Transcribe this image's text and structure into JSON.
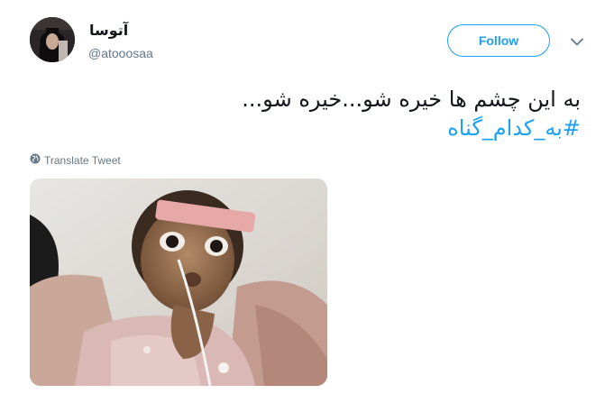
{
  "user": {
    "display_name": "آتوسا",
    "handle": "@atooosaa",
    "avatar_icon": "profile-photo"
  },
  "follow_label": "Follow",
  "tweet": {
    "text_line1": "به این چشم ها خیره شو...خیره شو...",
    "hashtag": "#به_کدام_گناه"
  },
  "translate_label": "Translate Tweet",
  "colors": {
    "accent": "#1da1f2",
    "text": "#14171a",
    "secondary": "#657786"
  },
  "icons": {
    "caret": "chevron-down-icon",
    "globe": "globe-icon"
  }
}
